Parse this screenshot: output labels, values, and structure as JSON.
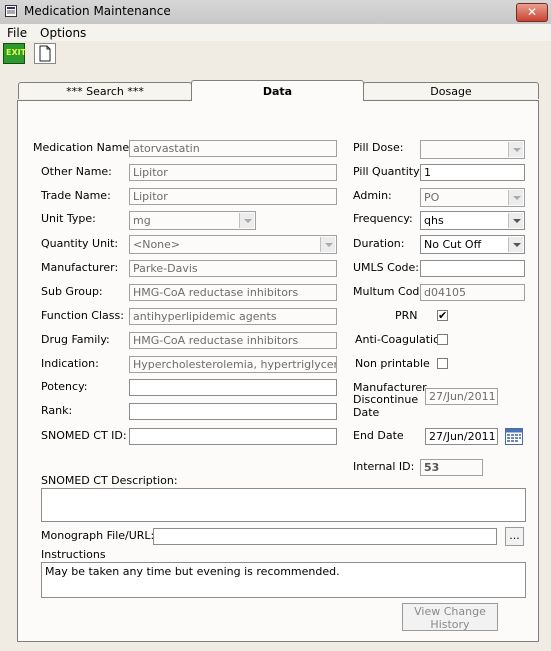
{
  "window": {
    "title": "Medication Maintenance",
    "close_glyph": "✕"
  },
  "menu": [
    "File",
    "Options"
  ],
  "toolbar": {
    "exit_label": "EXIT"
  },
  "tabs": [
    {
      "label": "*** Search ***",
      "active": false
    },
    {
      "label": "Data",
      "active": true
    },
    {
      "label": "Dosage",
      "active": false
    }
  ],
  "left_fields": [
    {
      "label": "Medication Name:",
      "value": "atorvastatin"
    },
    {
      "label": "Other Name:",
      "value": "Lipitor"
    },
    {
      "label": "Trade Name:",
      "value": "Lipitor"
    },
    {
      "label": "Unit Type:",
      "value": "mg"
    },
    {
      "label": "Quantity Unit:",
      "value": "<None>"
    },
    {
      "label": "Manufacturer:",
      "value": "Parke-Davis"
    },
    {
      "label": "Sub Group:",
      "value": "HMG-CoA reductase inhibitors"
    },
    {
      "label": "Function Class:",
      "value": "antihyperlipidemic agents"
    },
    {
      "label": "Drug Family:",
      "value": "HMG-CoA reductase inhibitors"
    },
    {
      "label": "Indication:",
      "value": "Hypercholesterolemia, hypertriglyceridemia"
    },
    {
      "label": "Potency:",
      "value": ""
    },
    {
      "label": "Rank:",
      "value": ""
    },
    {
      "label": "SNOMED CT ID:",
      "value": ""
    }
  ],
  "right_fields": [
    {
      "label": "Pill Dose:",
      "value": ""
    },
    {
      "label": "Pill Quantity:",
      "value": "1"
    },
    {
      "label": "Admin:",
      "value": "PO"
    },
    {
      "label": "Frequency:",
      "value": "qhs"
    },
    {
      "label": "Duration:",
      "value": "No Cut Off"
    },
    {
      "label": "UMLS Code:",
      "value": ""
    },
    {
      "label": "Multum Code:",
      "value": "d04105"
    }
  ],
  "checks": {
    "prn": {
      "label": "PRN",
      "checked": true,
      "mark": "✔"
    },
    "anticoag": {
      "label": "Anti-Coagulation",
      "checked": false
    },
    "nonprint": {
      "label": "Non printable",
      "checked": false
    }
  },
  "mfr_discontinue": {
    "label_line1": "Manufacturer",
    "label_line2": "Discontinue",
    "label_line3": "Date",
    "value": "27/Jun/2011"
  },
  "end_date": {
    "label": "End Date",
    "value": "27/Jun/2011"
  },
  "internal_id": {
    "label": "Internal ID:",
    "value": "53"
  },
  "snomed_description": {
    "label": "SNOMED CT Description:",
    "value": ""
  },
  "monograph": {
    "label": "Monograph File/URL:",
    "value": "",
    "browse_label": "..."
  },
  "instructions": {
    "label": "Instructions",
    "value": "May be taken any time but evening is recommended."
  },
  "history_button": {
    "line1": "View Change",
    "line2": "History"
  },
  "colors": {
    "accent_close": "#c9432f",
    "panel_bg": "#fdfbf9",
    "window_bg": "#f0ece4"
  }
}
